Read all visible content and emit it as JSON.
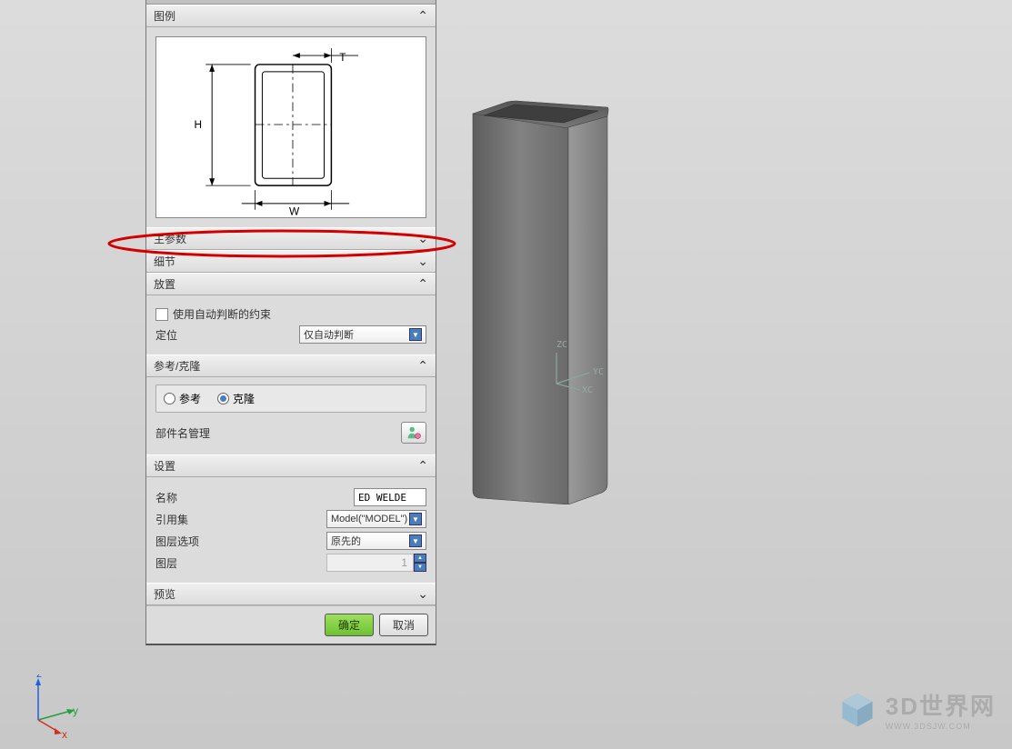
{
  "sections": {
    "legend": "图例",
    "main_params": "主参数",
    "detail": "细节",
    "placement": "放置",
    "refclone": "参考/克隆",
    "settings": "设置",
    "preview": "预览"
  },
  "diagram": {
    "H": "H",
    "W": "W",
    "T": "T"
  },
  "placement": {
    "auto_constraint": "使用自动判断的约束",
    "auto_constraint_checked": false,
    "position_label": "定位",
    "position_value": "仅自动判断"
  },
  "refclone": {
    "ref": "参考",
    "clone": "克隆",
    "selected": "clone",
    "part_mgmt": "部件名管理"
  },
  "settings": {
    "name_label": "名称",
    "name_value": "ED WELDE",
    "refset_label": "引用集",
    "refset_value": "Model(\"MODEL\")",
    "layer_opt_label": "图层选项",
    "layer_opt_value": "原先的",
    "layer_label": "图层",
    "layer_value": "1"
  },
  "buttons": {
    "ok": "确定",
    "cancel": "取消"
  },
  "wcs": {
    "z": "ZC",
    "y": "YC",
    "x": "XC"
  },
  "triad": {
    "z": "z",
    "y": "y",
    "x": "x"
  },
  "watermark": {
    "title": "3D世界网",
    "url": "WWW.3DSJW.COM"
  }
}
